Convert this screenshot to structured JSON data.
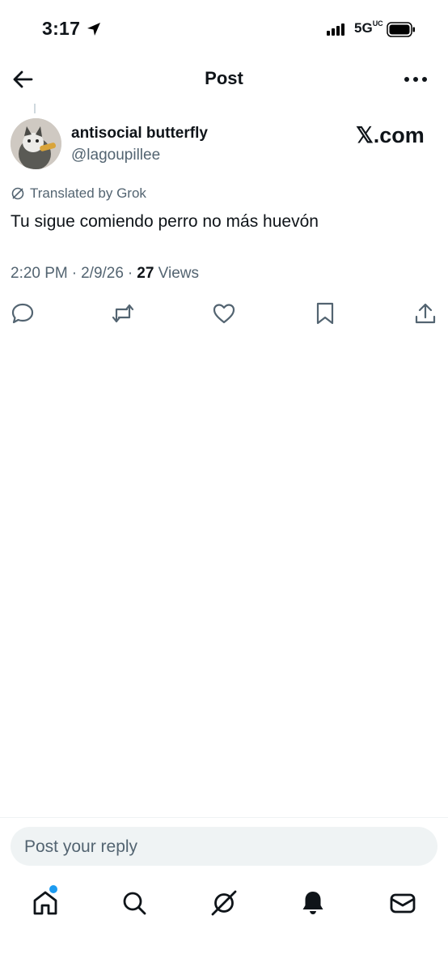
{
  "status_bar": {
    "time": "3:17",
    "network": "5G",
    "network_sub": "UC"
  },
  "header": {
    "title": "Post"
  },
  "post": {
    "display_name": "antisocial butterfly",
    "handle": "@lagoupillee",
    "brand_watermark": "𝕏.com",
    "translated_label": "Translated by Grok",
    "text": "Tu sigue comiendo perro no más huevón",
    "time": "2:20 PM",
    "date": "2/9/26",
    "views_count": "27",
    "views_label": "Views",
    "separator": "·"
  },
  "reply": {
    "placeholder": "Post your reply"
  },
  "icons": {
    "actions": [
      "reply-icon",
      "repost-icon",
      "like-icon",
      "bookmark-icon",
      "share-icon"
    ],
    "nav": [
      "home-icon",
      "search-icon",
      "grok-icon",
      "notifications-icon",
      "messages-icon"
    ]
  },
  "colors": {
    "text": "#0f1419",
    "secondary": "#536471",
    "accent": "#1d9bf0",
    "reply_bg": "#eff3f4"
  }
}
